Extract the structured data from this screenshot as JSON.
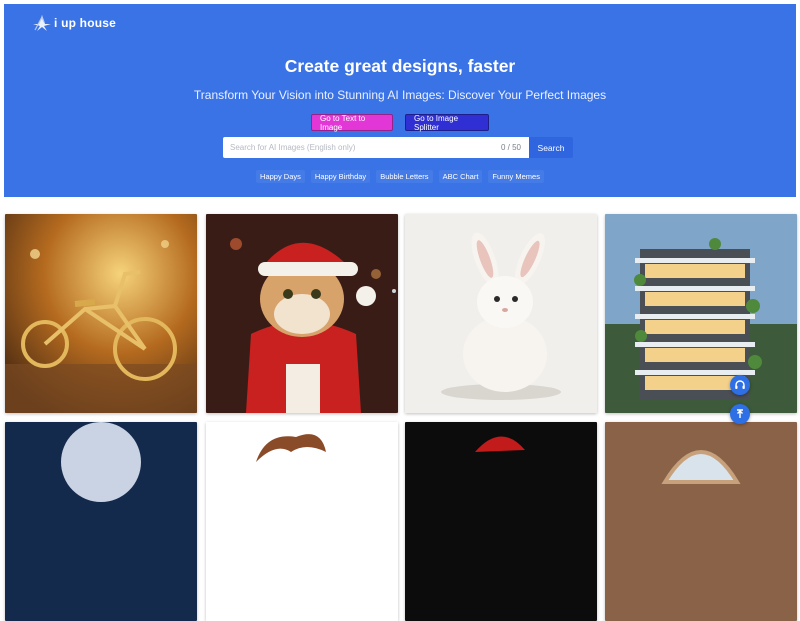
{
  "brand": {
    "name": "i up house",
    "icon": "logo-star-icon"
  },
  "hero": {
    "title": "Create great designs, faster",
    "subtitle": "Transform Your Vision into Stunning AI Images: Discover Your Perfect Images",
    "buttons": [
      {
        "label": "Go to Text to Image",
        "color": "#e236d6"
      },
      {
        "label": "Go to Image Splitter",
        "color": "#2f2fd4"
      }
    ]
  },
  "search": {
    "placeholder": "Search for AI Images (English only)",
    "char_count": "0 / 50",
    "button_label": "Search"
  },
  "tags": [
    "Happy Days",
    "Happy Birthday",
    "Bubble Letters",
    "ABC Chart",
    "Funny Memes"
  ],
  "gallery": [
    {
      "subject": "golden bicycle in autumn forest"
    },
    {
      "subject": "cat in santa costume"
    },
    {
      "subject": "white rabbit"
    },
    {
      "subject": "modern green apartment tower"
    },
    {
      "subject": "night sky with moon"
    },
    {
      "subject": "cartoon character"
    },
    {
      "subject": "red santa hat"
    },
    {
      "subject": "arched window"
    }
  ],
  "floating_buttons": [
    {
      "icon": "headphones-icon"
    },
    {
      "icon": "arrow-up-icon"
    }
  ],
  "colors": {
    "hero_bg": "#3a73e6",
    "accent": "#2f66e0"
  }
}
